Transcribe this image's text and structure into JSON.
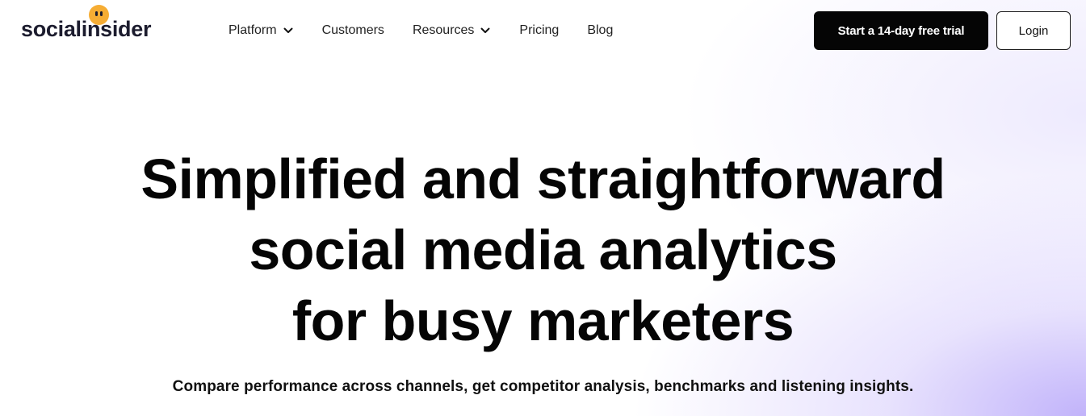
{
  "brand": {
    "name": "socialinsider",
    "accent": "#f6ad34"
  },
  "nav": {
    "items": [
      {
        "label": "Platform",
        "has_dropdown": true
      },
      {
        "label": "Customers",
        "has_dropdown": false
      },
      {
        "label": "Resources",
        "has_dropdown": true
      },
      {
        "label": "Pricing",
        "has_dropdown": false
      },
      {
        "label": "Blog",
        "has_dropdown": false
      }
    ]
  },
  "header": {
    "trial_button": "Start a 14-day free trial",
    "login_button": "Login"
  },
  "hero": {
    "title_lines": [
      "Simplified and straightforward",
      "social media analytics",
      "for busy marketers"
    ],
    "subtitle": "Compare performance across channels, get competitor analysis, benchmarks and listening insights."
  },
  "colors": {
    "primary_button": "#050505",
    "gradient_accent": "#beaffa"
  }
}
